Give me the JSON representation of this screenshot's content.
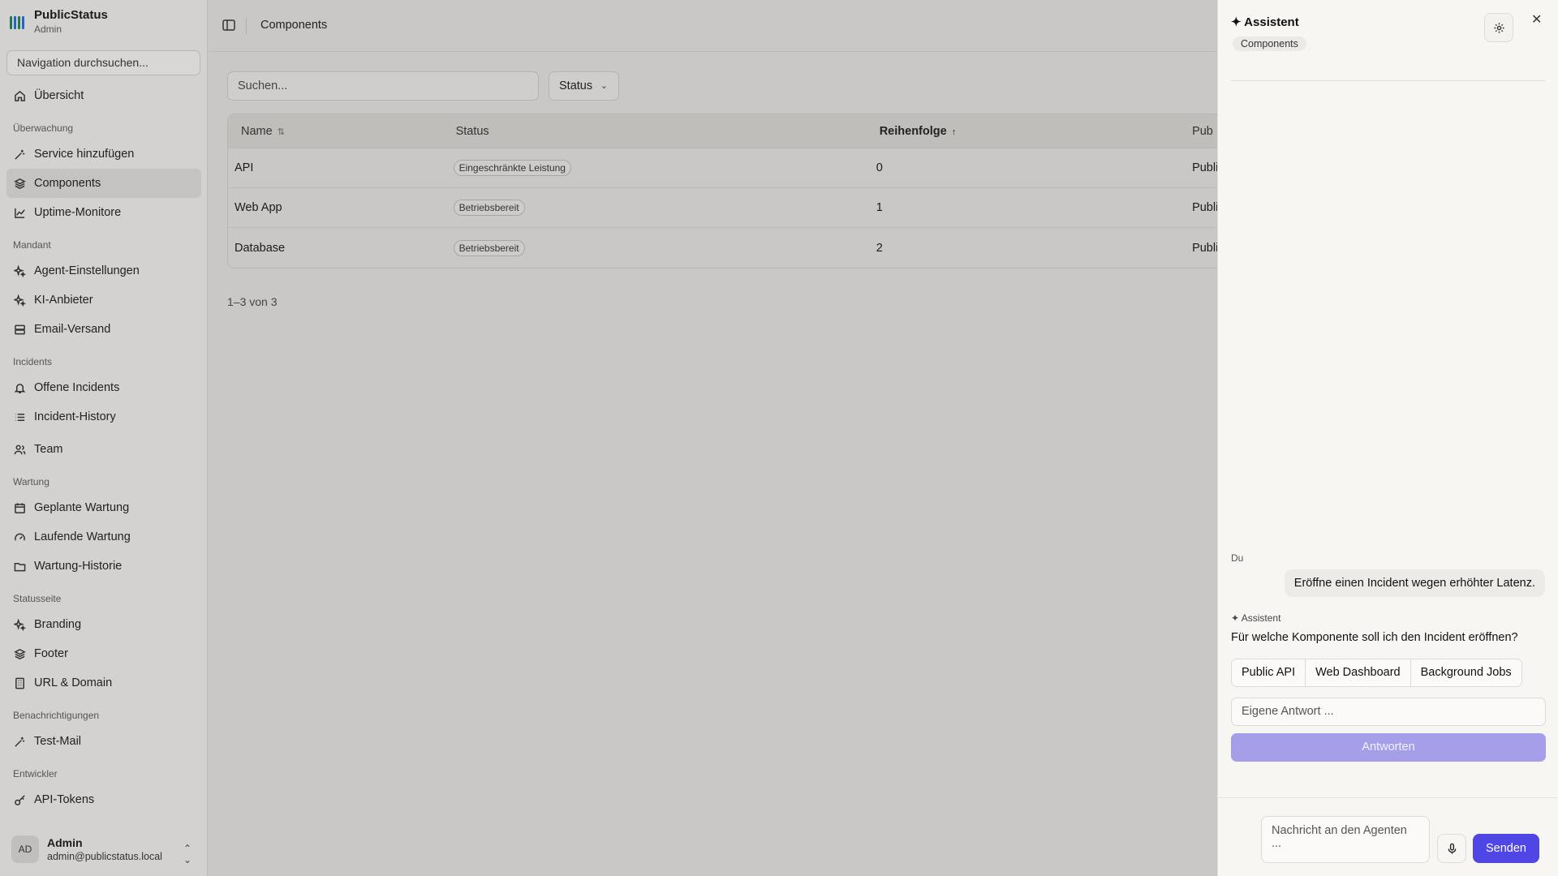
{
  "brand": {
    "name": "PublicStatus",
    "sub": "Admin"
  },
  "sidebar": {
    "search_placeholder": "Navigation durchsuchen...",
    "overview": "Übersicht",
    "groups": {
      "monitoring": "Überwachung",
      "tenant": "Mandant",
      "incidents": "Incidents",
      "maintenance": "Wartung",
      "statuspage": "Statusseite",
      "notifications": "Benachrichtigungen",
      "developer": "Entwickler"
    },
    "items": {
      "add_service": "Service hinzufügen",
      "components": "Components",
      "uptime": "Uptime-Monitore",
      "agent_settings": "Agent-Einstellungen",
      "ai_provider": "KI-Anbieter",
      "email": "Email-Versand",
      "open_incidents": "Offene Incidents",
      "incident_history": "Incident-History",
      "team": "Team",
      "planned": "Geplante Wartung",
      "running": "Laufende Wartung",
      "maint_history": "Wartung-Historie",
      "branding": "Branding",
      "footer": "Footer",
      "url_domain": "URL & Domain",
      "test_mail": "Test-Mail",
      "api_tokens": "API-Tokens"
    },
    "user": {
      "initials": "AD",
      "name": "Admin",
      "email": "admin@publicstatus.local"
    }
  },
  "header": {
    "breadcrumb": "Components"
  },
  "toolbar": {
    "search_placeholder": "Suchen...",
    "status_filter": "Status"
  },
  "table": {
    "columns": {
      "name": "Name",
      "status": "Status",
      "order": "Reihenfolge",
      "public": "Pub"
    },
    "rows": [
      {
        "name": "API",
        "status": "Eingeschränkte Leistung",
        "order": "0",
        "public": "Public"
      },
      {
        "name": "Web App",
        "status": "Betriebsbereit",
        "order": "1",
        "public": "Public"
      },
      {
        "name": "Database",
        "status": "Betriebsbereit",
        "order": "2",
        "public": "Public"
      }
    ],
    "pagination": "1–3 von 3"
  },
  "assistant": {
    "title": "✦ Assistent",
    "context_chip": "Components",
    "user_label": "Du",
    "user_message": "Eröffne einen Incident wegen erhöhter Latenz.",
    "ai_label": "✦ Assistent",
    "ai_question": "Für welche Komponente soll ich den Incident eröffnen?",
    "options": [
      "Public API",
      "Web Dashboard",
      "Background Jobs"
    ],
    "own_answer_placeholder": "Eigene Antwort ...",
    "answer_button": "Antworten",
    "message_placeholder": "Nachricht an den Agenten ...",
    "send_button": "Senden"
  },
  "colors": {
    "accent": "#4f46e5",
    "accent_disabled": "#a59ee8"
  }
}
